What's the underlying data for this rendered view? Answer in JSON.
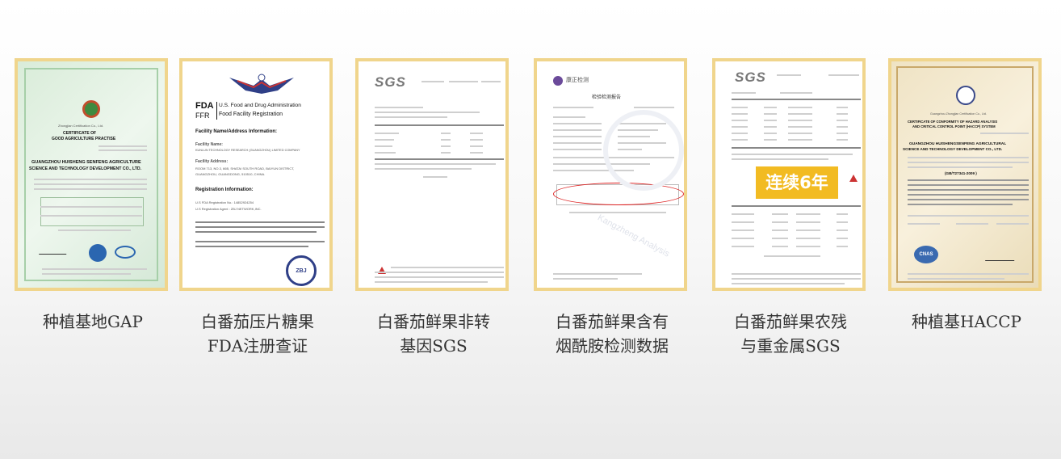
{
  "certificates": [
    {
      "caption": "种植基地GAP",
      "doc": {
        "issuer": "Zhongjian Certification Co., Ltd.",
        "title_1": "CERTIFICATE OF",
        "title_2": "GOOD AGRICULTURE PRACTISE",
        "company_1": "GUANGZHOU HUISHENG SENFENG AGRICULTURE",
        "company_2": "SCIENCE AND TECHNOLOGY DEVELOPMENT CO., LTD."
      }
    },
    {
      "caption": "白番茄压片糖果\nFDA注册查证",
      "doc": {
        "fda": "FDA",
        "ffr": "FFR",
        "header_1": "U.S. Food and Drug Administration",
        "header_2": "Food Facility Registration",
        "facility_heading": "Facility Name/Address Information:",
        "facility_name": "KUNLUN TECHNOLOGY RESEARCH (GUANGZHOU) LIMITED COMPANY",
        "address_heading": "Facility Address:",
        "address_1": "ROOM 713, NO.3, 66B, SHATAI SOUTH ROAD, BAIYUN DISTRICT,",
        "address_2": "GUANGZHOU, GUANGDONG, 510510, CHINA.",
        "registration_heading": "Registration Information:",
        "reg_number": "U.S FDA Registration No.: 14852924254",
        "reg_agent": "U.S Registration Agent : ZBJ NETWORK,INC.",
        "seal": "ZBJ"
      }
    },
    {
      "caption": "白番茄鲜果非转\n基因SGS",
      "doc": {
        "logo": "SGS"
      }
    },
    {
      "caption": "白番茄鲜果含有\n烟酰胺检测数据",
      "doc": {
        "logo": "康正检测",
        "title": "检验检测报告",
        "watermark": "Kangzheng Analysis"
      }
    },
    {
      "caption": "白番茄鲜果农残\n与重金属SGS",
      "doc": {
        "logo": "SGS",
        "banner": "连续6年"
      }
    },
    {
      "caption": "种植基HACCP",
      "doc": {
        "issuer": "Guangzhou Zhongjian Certification Co., Ltd.",
        "title_1": "CERTIFICATE OF CONFORMITY OF HAZARD ANALYSIS",
        "title_2": "AND CRITICAL CONTROL POINT (HACCP) SYSTEM",
        "company_1": "GUANGZHOU HUISHENGSENFENG AGRICULTURAL",
        "company_2": "SCIENCE AND TECHNOLOGY DEVELOPMENT CO., LTD.",
        "standard": "(GB/T27341-2009 )",
        "logo": "CNAS"
      }
    }
  ],
  "colors": {
    "frame": "#f0d58c",
    "banner": "#f2bb22",
    "caption": "#333333"
  }
}
